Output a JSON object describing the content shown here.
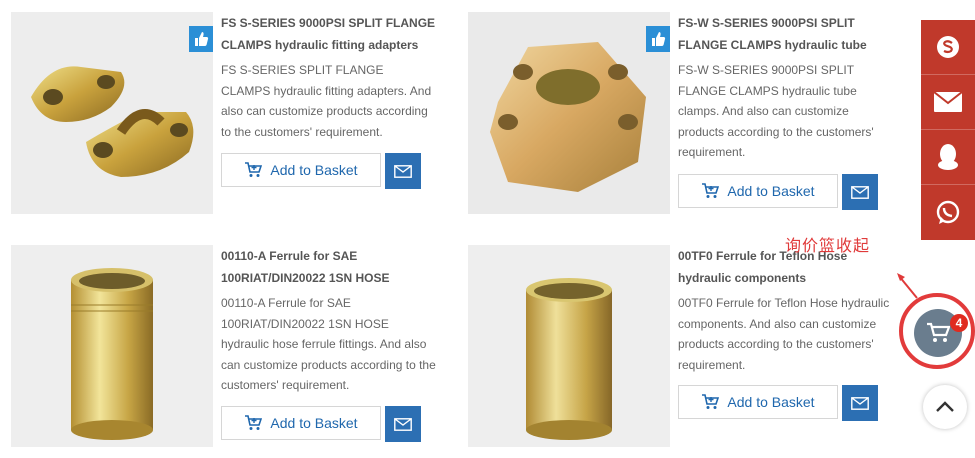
{
  "products": [
    {
      "title": "FS S-SERIES 9000PSI SPLIT FLANGE CLAMPS hydraulic fitting adapters",
      "description": "FS S-SERIES SPLIT FLANGE CLAMPS hydraulic fitting adapters. And also can customize products according to the customers' requirement.",
      "basket_label": "Add to Basket",
      "image": "split-flange-clamp-pair"
    },
    {
      "title": "FS-W S-SERIES 9000PSI SPLIT FLANGE CLAMPS hydraulic tube",
      "description": "FS-W S-SERIES 9000PSI SPLIT FLANGE CLAMPS hydraulic tube clamps. And also can customize products according to the customers' requirement.",
      "basket_label": "Add to Basket",
      "image": "four-bolt-flange"
    },
    {
      "title": "00110-A Ferrule for SAE 100RIAT/DIN20022 1SN HOSE",
      "description": "00110-A Ferrule for SAE 100RIAT/DIN20022 1SN HOSE hydraulic hose ferrule fittings. And also can customize products according to the customers' requirement.",
      "basket_label": "Add to Basket",
      "image": "ferrule-grooved"
    },
    {
      "title": "00TF0 Ferrule for Teflon Hose hydraulic components",
      "description": "00TF0 Ferrule for Teflon Hose hydraulic components. And also can customize products according to the customers' requirement.",
      "basket_label": "Add to Basket",
      "image": "ferrule-plain"
    }
  ],
  "float_bar": {
    "items": [
      "skype-icon",
      "email-icon",
      "qq-icon",
      "whatsapp-icon"
    ],
    "color": "#c0392b"
  },
  "annotation": "询价篮收起",
  "cart": {
    "count": "4"
  },
  "colors": {
    "accent": "#2c6fb3",
    "like": "#2b8fd6",
    "annotation": "#e03a3a"
  }
}
